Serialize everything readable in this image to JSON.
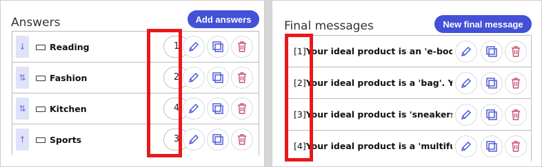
{
  "answers_panel": {
    "title": "Answers",
    "add_button": "Add answers",
    "rows": [
      {
        "label": "Reading",
        "order": "1",
        "handle": "↓"
      },
      {
        "label": "Fashion",
        "order": "2",
        "handle": "⇅"
      },
      {
        "label": "Kitchen",
        "order": "4",
        "handle": "⇅"
      },
      {
        "label": "Sports",
        "order": "3",
        "handle": "↑"
      }
    ]
  },
  "final_panel": {
    "title": "Final messages",
    "new_button": "New final message",
    "rows": [
      {
        "num": "[1]",
        "text": "Your ideal product is an 'e-book re"
      },
      {
        "num": "[2]",
        "text": "Your ideal product is a 'bag'. Your r"
      },
      {
        "num": "[3]",
        "text": "Your ideal product is 'sneakers'. Yo"
      },
      {
        "num": "[4]",
        "text": "Your ideal product is a 'multifunctio"
      }
    ]
  },
  "icons": {
    "edit": "pencil-icon",
    "duplicate": "duplicate-icon",
    "delete": "trash-icon"
  },
  "colors": {
    "accent": "#4251d6",
    "delete": "#c8506a",
    "highlight": "#e8191c",
    "handle_bg": "#dfe2f8"
  }
}
